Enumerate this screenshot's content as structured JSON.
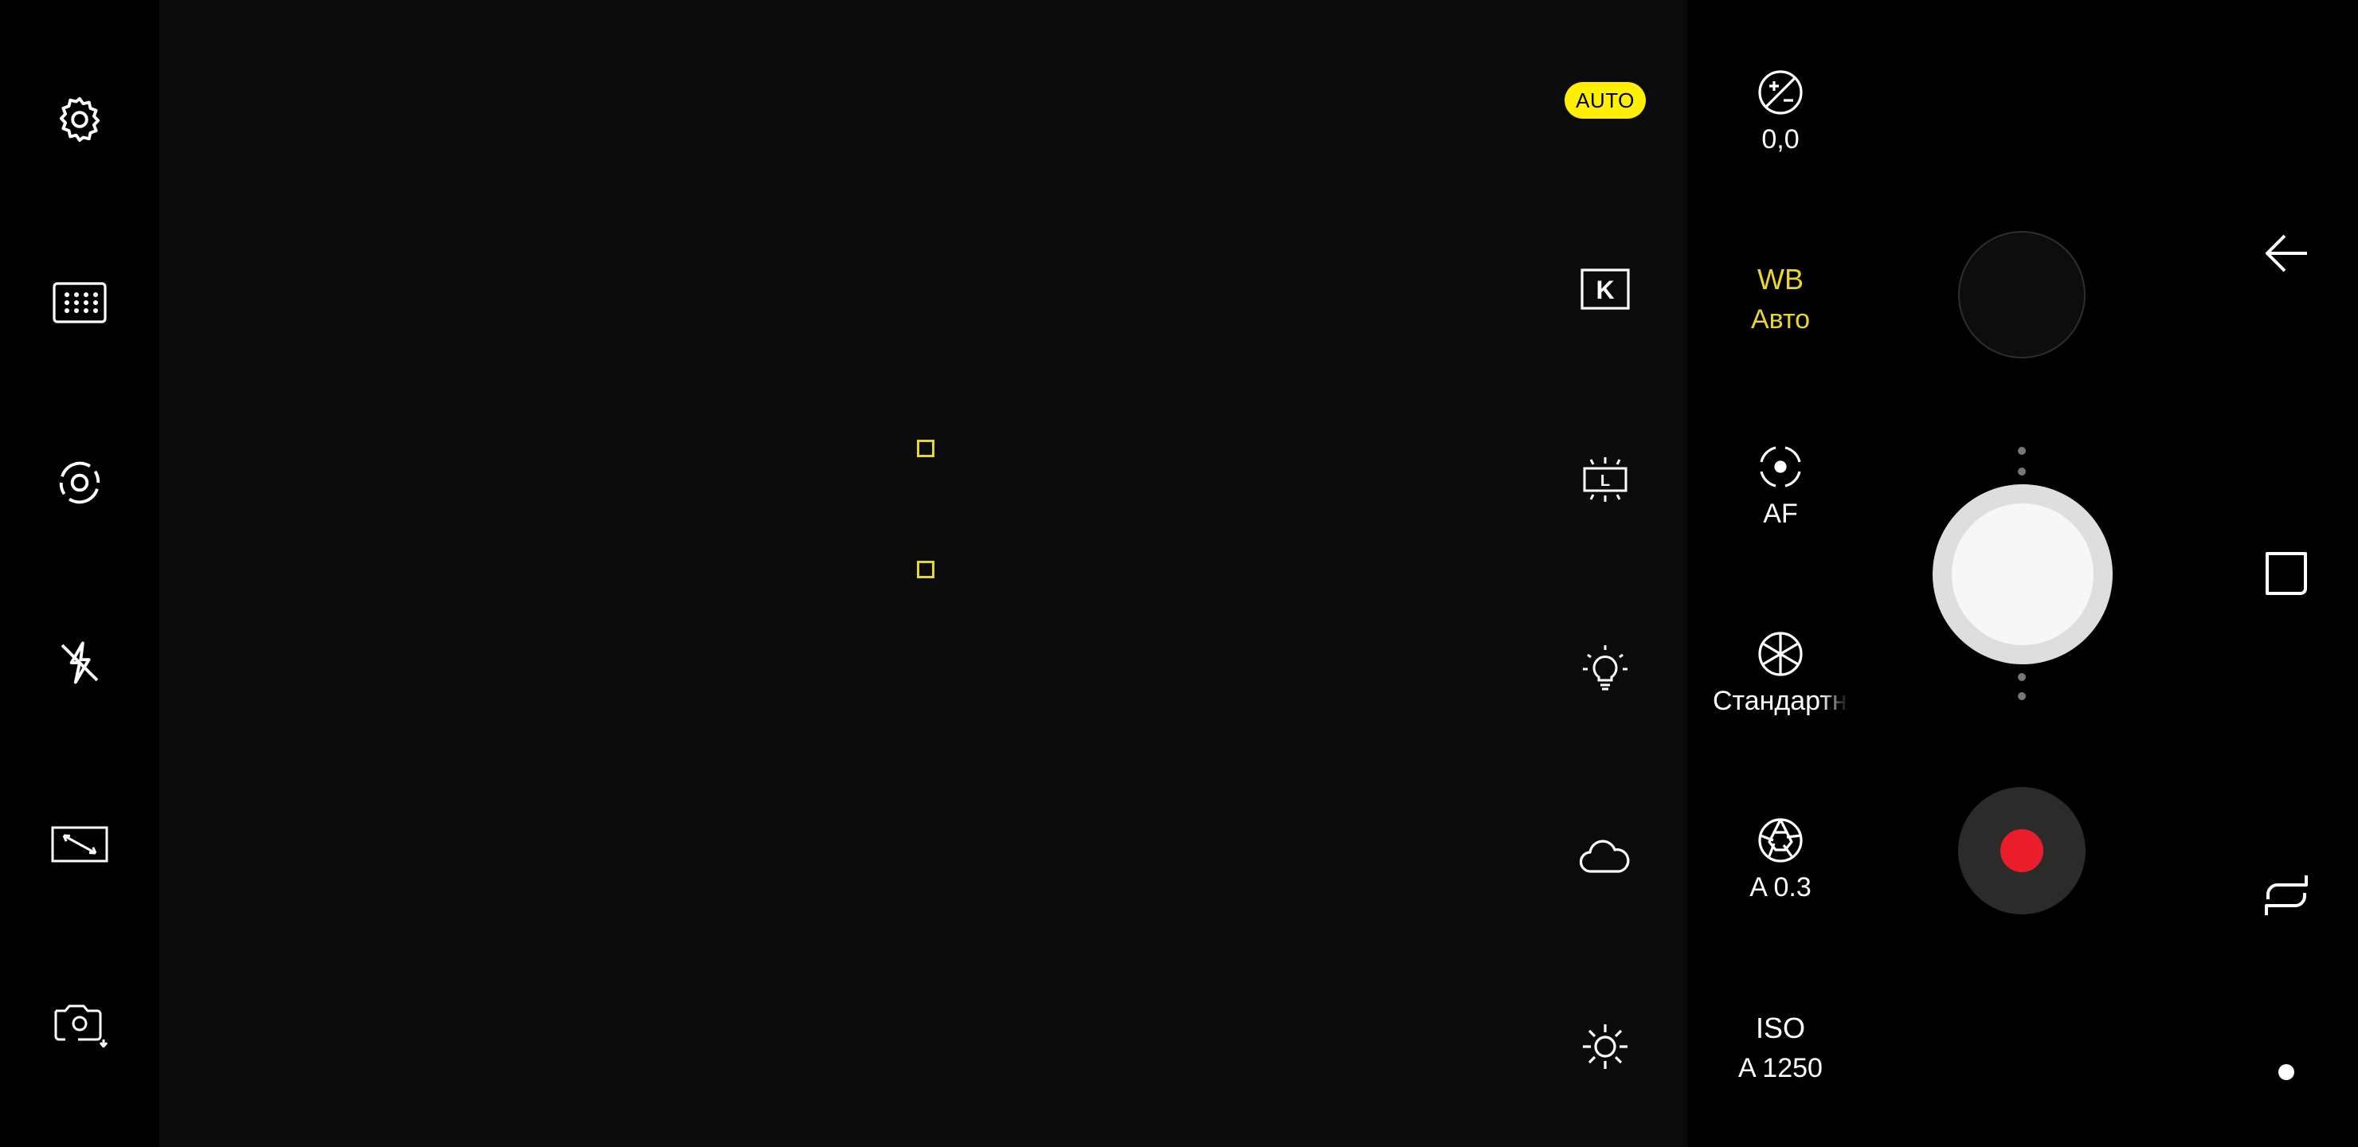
{
  "left_toolbar": {
    "icons": [
      "gear-icon",
      "grid-icon",
      "camera-mode-icon",
      "flash-off-icon",
      "aspect-ratio-icon",
      "switch-camera-icon"
    ]
  },
  "presets": {
    "auto_label": "AUTO",
    "k_label": "K",
    "l_label": "L",
    "icons": [
      "kelvin-icon",
      "fluorescent-icon",
      "incandescent-icon",
      "cloudy-icon",
      "daylight-icon"
    ]
  },
  "controls": {
    "exposure": {
      "icon": "exposure-compensation-icon",
      "value": "0,0"
    },
    "white_balance": {
      "label": "WB",
      "value": "Авто"
    },
    "focus": {
      "icon": "autofocus-icon",
      "value": "AF"
    },
    "color": {
      "icon": "aperture-color-icon",
      "value": "Стандартный"
    },
    "shutter": {
      "icon": "shutter-aperture-icon",
      "value": "A 0.3"
    },
    "iso": {
      "label": "ISO",
      "value": "A 1250"
    }
  },
  "colors": {
    "accent_yellow": "#e8d72a",
    "auto_badge": "#ffef00",
    "record_red": "#ec1d2a"
  },
  "nav": {
    "icons": [
      "back-icon",
      "recent-apps-icon",
      "overview-icon",
      "home-dot-icon"
    ]
  }
}
